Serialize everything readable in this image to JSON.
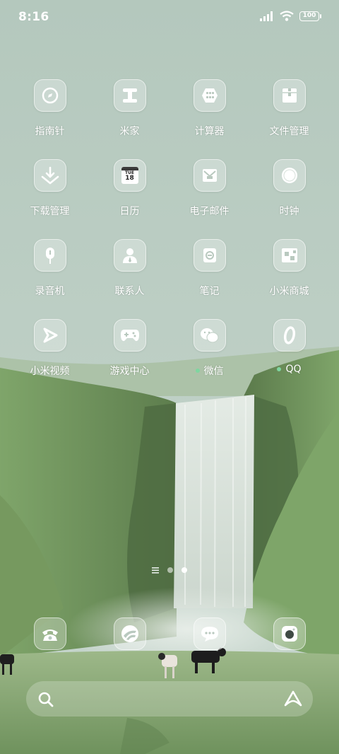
{
  "status_bar": {
    "time": "8:16",
    "battery": "100"
  },
  "apps": [
    {
      "label": "指南针",
      "icon": "compass-icon"
    },
    {
      "label": "米家",
      "icon": "mijia-icon"
    },
    {
      "label": "计算器",
      "icon": "calculator-icon"
    },
    {
      "label": "文件管理",
      "icon": "file-manager-icon"
    },
    {
      "label": "下载管理",
      "icon": "download-icon"
    },
    {
      "label": "日历",
      "icon": "calendar-icon",
      "calendar_day": "TUE",
      "calendar_date": "18"
    },
    {
      "label": "电子邮件",
      "icon": "mail-icon"
    },
    {
      "label": "时钟",
      "icon": "clock-icon"
    },
    {
      "label": "录音机",
      "icon": "recorder-icon"
    },
    {
      "label": "联系人",
      "icon": "contacts-icon"
    },
    {
      "label": "笔记",
      "icon": "notes-icon"
    },
    {
      "label": "小米商城",
      "icon": "mi-store-icon"
    },
    {
      "label": "小米视频",
      "icon": "video-icon"
    },
    {
      "label": "游戏中心",
      "icon": "gamepad-icon"
    },
    {
      "label": "微信",
      "icon": "wechat-icon",
      "new_dot": true
    },
    {
      "label": "QQ",
      "icon": "qq-icon",
      "new_dot": true
    }
  ],
  "dock": [
    {
      "icon": "phone-icon"
    },
    {
      "icon": "browser-icon"
    },
    {
      "icon": "messages-icon"
    },
    {
      "icon": "camera-icon"
    }
  ],
  "page_indicator": {
    "pages": 2,
    "active": 2
  },
  "colors": {
    "new_dot": "#7ed6a0",
    "sky": "#bccdc4",
    "grass": "#7a9e64"
  }
}
